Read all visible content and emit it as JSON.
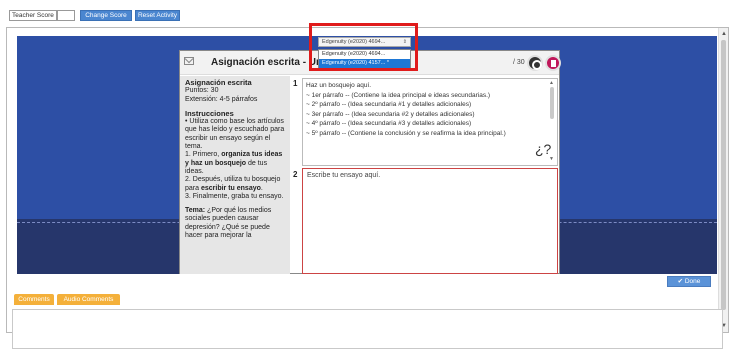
{
  "toolbar": {
    "teacher_score_label": "Teacher Score",
    "teacher_score_value": "",
    "change_score_label": "Change Score",
    "reset_activity_label": "Reset Activity"
  },
  "card": {
    "title": "Asignación escrita - Unidad",
    "points": "/ 30",
    "instructions": {
      "heading": "Asignación escrita",
      "points_line": "Puntos: 30",
      "length_line": "Extensión: 4-5 párrafos",
      "instr_heading": "Instrucciones",
      "bullet": "• Utiliza como base los artículos que has leído y escuchado para escribir un ensayo según el tema.",
      "step1_prefix": "1. Primero, ",
      "step1_bold": "organiza tus ideas y haz un bosquejo",
      "step1_suffix": " de tus ideas.",
      "step2_prefix": "2. Después, utiliza tu bosquejo para ",
      "step2_bold": "escribir tu ensayo",
      "step2_suffix": ".",
      "step3": "3. Finalmente, graba tu ensayo.",
      "topic_label": "Tema:",
      "topic_text": " ¿Por qué los medios sociales pueden causar depresión? ¿Qué se puede hacer para mejorar la"
    },
    "box1_number": "1",
    "box1_lines": [
      "Haz un bosquejo aquí.",
      "~ 1er párrafo -- (Contiene la idea principal e ideas secundarias.)",
      "~ 2º párrafo -- (Idea secundaria #1 y detalles adicionales)",
      "~ 3er párrafo -- (Idea secundaria #2 y detalles adicionales)",
      "~ 4º párrafo -- (Idea secundaria #3 y detalles adicionales)",
      "~ 5º párrafo -- (Contiene la conclusión y se reafirma la idea principal.)"
    ],
    "box2_number": "2",
    "box2_text": "Escribe tu ensayo aquí."
  },
  "dropdown": {
    "selected": "Edgenuity (e2020) 4694...",
    "options": [
      "Edgenuity (e2020) 4694...",
      "Edgenuity (e2020) 4157... *"
    ],
    "highlighted_index": 1
  },
  "done_label": "✔ Done",
  "tabs": {
    "comments": "Comments",
    "audio_comments": "Audio Comments"
  },
  "icons": {
    "help": "¿?"
  }
}
